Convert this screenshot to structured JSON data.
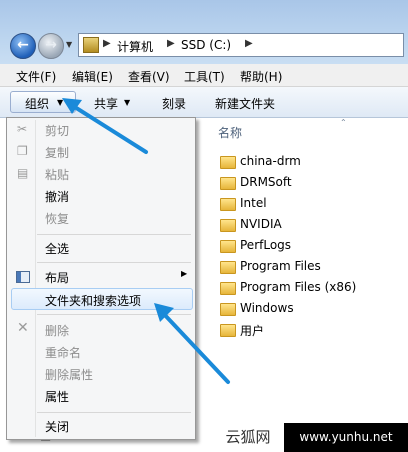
{
  "address": {
    "crumbs": [
      "计算机",
      "SSD (C:)"
    ]
  },
  "menubar": [
    "文件(F)",
    "编辑(E)",
    "查看(V)",
    "工具(T)",
    "帮助(H)"
  ],
  "toolbar": {
    "organize": "组织",
    "share": "共享",
    "burn": "刻录",
    "new_folder": "新建文件夹"
  },
  "files": {
    "column_header": "名称",
    "items": [
      "china-drm",
      "DRMSoft",
      "Intel",
      "NVIDIA",
      "PerfLogs",
      "Program Files",
      "Program Files (x86)",
      "Windows",
      "用户"
    ]
  },
  "organize_menu": {
    "cut": "剪切",
    "copy": "复制",
    "paste": "粘贴",
    "undo": "撤消",
    "redo": "恢复",
    "select_all": "全选",
    "layout": "布局",
    "folder_options": "文件夹和搜索选项",
    "delete": "删除",
    "rename": "重命名",
    "remove_properties": "删除属性",
    "properties": "属性",
    "close": "关闭"
  },
  "watermark": {
    "left": "云狐网",
    "right": "www.yunhu.net"
  },
  "colors": {
    "arrow": "#1a8ad9",
    "highlight_border": "#a8cdf3"
  },
  "icons": {
    "back": "back-arrow-icon",
    "forward": "forward-arrow-icon",
    "folder": "folder-icon"
  }
}
